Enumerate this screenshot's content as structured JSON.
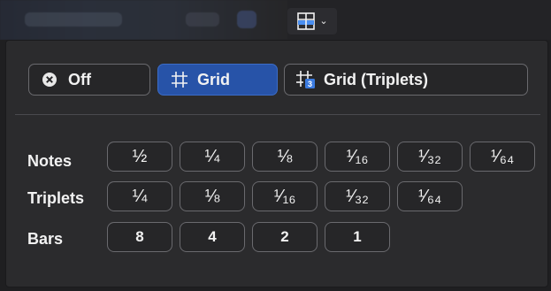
{
  "toolbar": {
    "snap_toggle_icon": "snap-grid-icon",
    "dropdown_icon": "chevron-down-icon"
  },
  "modes": [
    {
      "label": "Off",
      "icon": "x-circle-icon",
      "active": false
    },
    {
      "label": "Grid",
      "icon": "grid-icon",
      "active": true
    },
    {
      "label": "Grid (Triplets)",
      "icon": "grid-triplets-icon",
      "active": false
    }
  ],
  "rows": {
    "notes": {
      "label": "Notes",
      "values": [
        "½",
        "¼",
        "⅛",
        "¹⁄₁₆",
        "¹⁄₃₂",
        "¹⁄₆₄"
      ]
    },
    "triplets": {
      "label": "Triplets",
      "values": [
        "¼",
        "⅛",
        "¹⁄₁₆",
        "¹⁄₃₂",
        "¹⁄₆₄"
      ]
    },
    "bars": {
      "label": "Bars",
      "values": [
        "8",
        "4",
        "2",
        "1"
      ]
    }
  },
  "colors": {
    "accent": "#2753a8",
    "panel_bg": "#2b2b2d",
    "button_border": "#6a6a6e"
  }
}
